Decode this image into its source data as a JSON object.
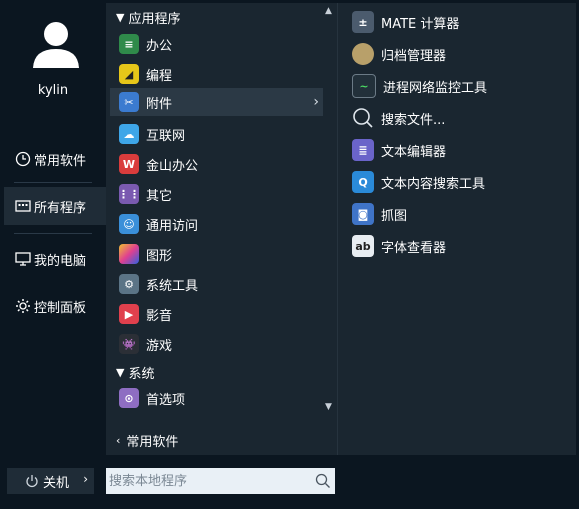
{
  "user": {
    "name": "kylin"
  },
  "nav": [
    {
      "label": "常用软件",
      "icon": "clock-icon"
    },
    {
      "label": "所有程序",
      "icon": "apps-grid-icon"
    },
    {
      "label": "我的电脑",
      "icon": "monitor-icon"
    },
    {
      "label": "控制面板",
      "icon": "gear-icon"
    }
  ],
  "categories": {
    "header": "应用程序",
    "items": [
      {
        "label": "办公",
        "icon": "office-icon",
        "color": "#2f8a4a"
      },
      {
        "label": "编程",
        "icon": "programming-icon",
        "color": "#e6c619"
      },
      {
        "label": "附件",
        "icon": "accessories-icon",
        "color": "#3b7bd0"
      },
      {
        "label": "互联网",
        "icon": "internet-cloud-icon",
        "color": "#3ea6e8"
      },
      {
        "label": "金山办公",
        "icon": "wps-icon",
        "color": "#d93c3c"
      },
      {
        "label": "其它",
        "icon": "other-apps-icon",
        "color": "#7a5ab0"
      },
      {
        "label": "通用访问",
        "icon": "accessibility-icon",
        "color": "#3a8fd9"
      },
      {
        "label": "图形",
        "icon": "graphics-icon",
        "color": "#c94fb8"
      },
      {
        "label": "系统工具",
        "icon": "system-tools-icon",
        "color": "#5b7486"
      },
      {
        "label": "影音",
        "icon": "multimedia-icon",
        "color": "#e0404d"
      },
      {
        "label": "游戏",
        "icon": "games-icon",
        "color": "#2b2f36"
      }
    ],
    "system_header": "系统",
    "system_items": [
      {
        "label": "首选项",
        "icon": "preferences-icon",
        "color": "#8e6dc2"
      }
    ],
    "back_label": "常用软件"
  },
  "apps": [
    {
      "label": "MATE 计算器",
      "icon": "calculator-icon",
      "color": "#4b5b6d"
    },
    {
      "label": "归档管理器",
      "icon": "archive-icon",
      "color": "#b8a06a"
    },
    {
      "label": "进程网络监控工具",
      "icon": "network-monitor-icon",
      "color": "#2f7a3a"
    },
    {
      "label": "搜索文件...",
      "icon": "search-icon",
      "color": "#1a2630"
    },
    {
      "label": "文本编辑器",
      "icon": "text-editor-icon",
      "color": "#6a64c9"
    },
    {
      "label": "文本内容搜索工具",
      "icon": "text-search-icon",
      "color": "#2a8ad8"
    },
    {
      "label": "抓图",
      "icon": "screenshot-icon",
      "color": "#3f74c8"
    },
    {
      "label": "字体查看器",
      "icon": "font-viewer-icon",
      "color": "#e8edf2"
    }
  ],
  "bottom": {
    "shutdown_label": "关机",
    "search_placeholder": "搜索本地程序"
  }
}
